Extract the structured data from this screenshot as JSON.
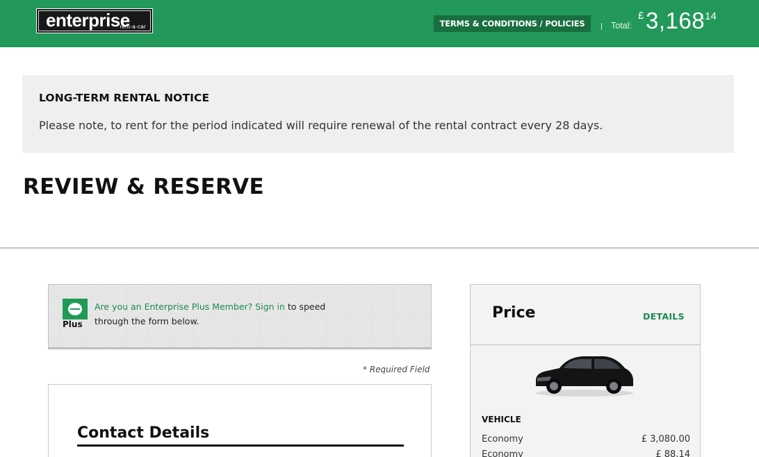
{
  "header": {
    "logo_text": "enterprise",
    "logo_subtext": "rent-a-car",
    "terms_label": "TERMS & CONDITIONS / POLICIES",
    "total_label": "Total:",
    "total_currency": "£",
    "total_main": "3,168",
    "total_cents": ".14",
    "brand_color": "#22985a"
  },
  "notice": {
    "title": "LONG-TERM RENTAL NOTICE",
    "text": "Please note, to rent for the period indicated will require renewal of the rental contract every 28 days."
  },
  "page_title": "REVIEW & RESERVE",
  "plus": {
    "logo_text": "Plus",
    "link_text": "Are you an Enterprise Plus Member? Sign in",
    "rest_text": " to speed through the form below."
  },
  "required_note": "* Required Field",
  "contact": {
    "title": "Contact Details"
  },
  "price": {
    "title": "Price",
    "details_label": "DETAILS",
    "vehicle_label": "VEHICLE",
    "rows": [
      {
        "label": "Economy",
        "amount": "£ 3,080.00"
      },
      {
        "label": "Economy",
        "amount": "£ 88.14"
      }
    ]
  }
}
